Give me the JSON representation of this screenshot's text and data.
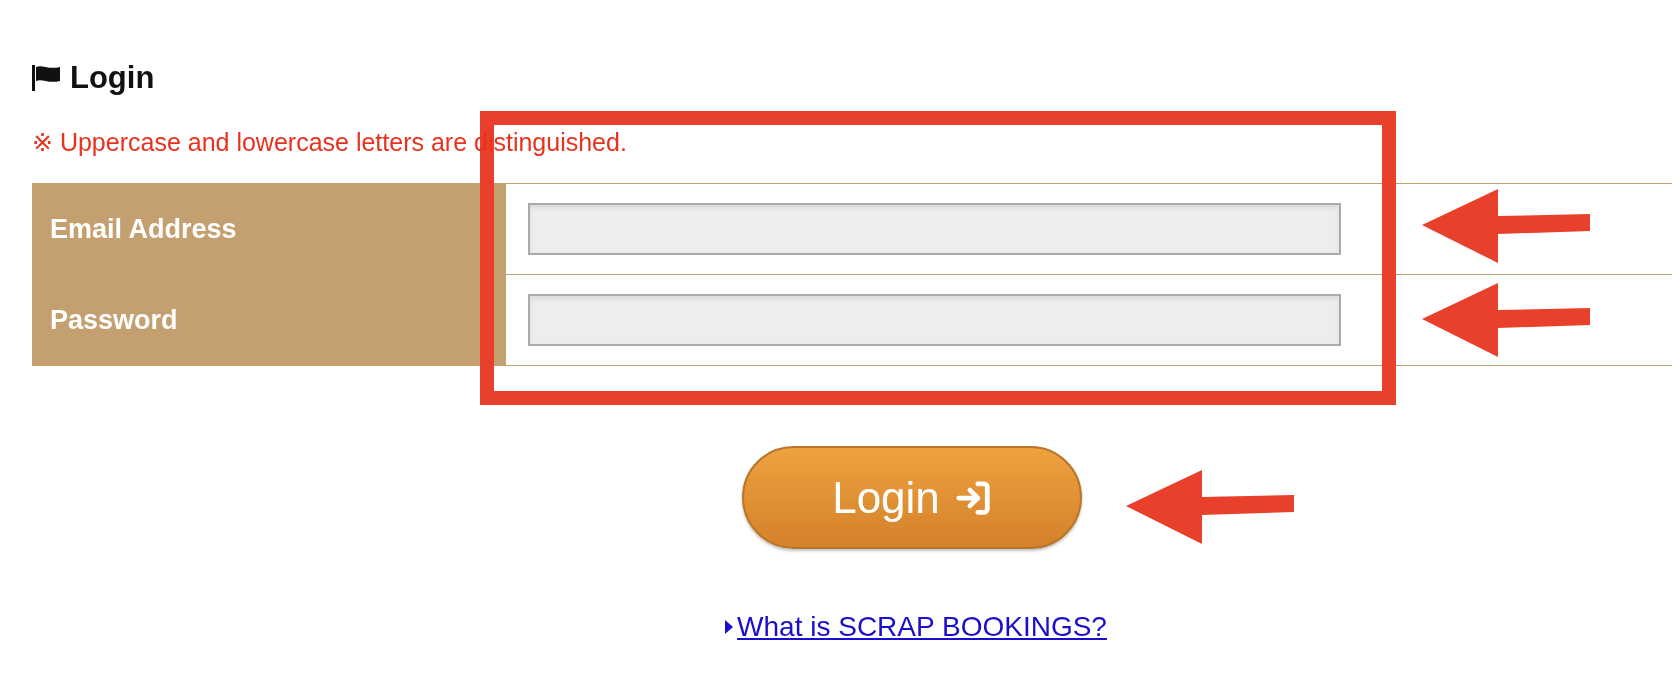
{
  "heading": "Login",
  "note": "※ Uppercase and lowercase letters are distinguished.",
  "fields": [
    {
      "label": "Email Address"
    },
    {
      "label": "Password"
    }
  ],
  "login_button": "Login",
  "link": "What is SCRAP BOOKINGS?"
}
